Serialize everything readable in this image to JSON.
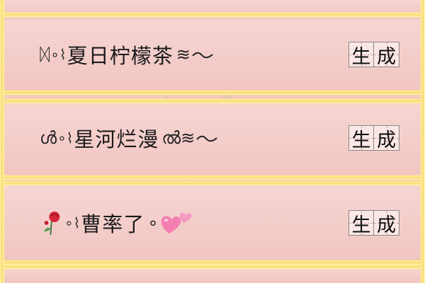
{
  "rows": [
    {
      "lead": "ᛞ",
      "sep": "∘⌇",
      "name": "夏日柠檬茶",
      "tail": "≋",
      "button": {
        "char1": "生",
        "char2": "成"
      }
    },
    {
      "lead": "ൾ",
      "sep": "∘⌇",
      "name": "星河烂漫",
      "tail": "ൽ≋",
      "button": {
        "char1": "生",
        "char2": "成"
      }
    },
    {
      "lead_icon": "rose-icon",
      "sep": "∘⌇",
      "name": "曹率了",
      "tail": "∘",
      "tail_icon": "two-hearts-icon",
      "button": {
        "char1": "生",
        "char2": "成"
      }
    }
  ],
  "colors": {
    "background": "#f2c9c6",
    "frame_gold": "#f8d96c",
    "text": "#1b1b1b",
    "heart": "#f47fb0",
    "rose": "#d6263a"
  }
}
